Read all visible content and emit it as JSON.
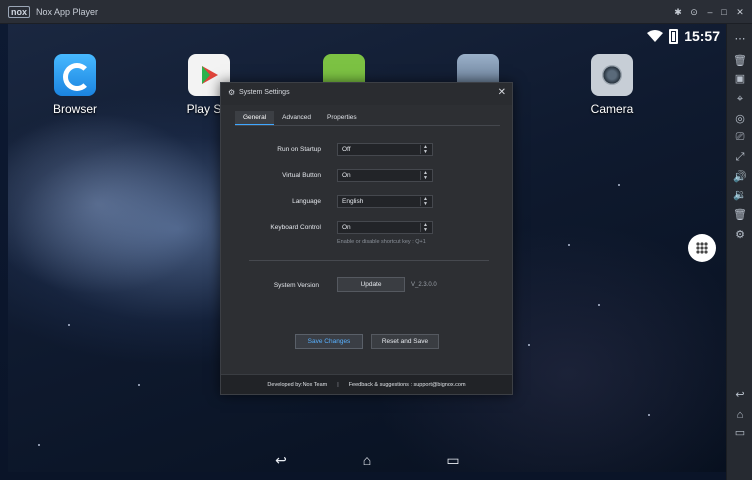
{
  "window": {
    "logo": "nox",
    "title": "Nox App Player"
  },
  "status": {
    "time": "15:57"
  },
  "apps": [
    {
      "label": "Browser",
      "icon": "browser-icon"
    },
    {
      "label": "Play Sto",
      "icon": "play-store-icon"
    },
    {
      "label": "",
      "icon": "games-icon"
    },
    {
      "label": "",
      "icon": "equalizer-icon"
    },
    {
      "label": "Camera",
      "icon": "camera-icon"
    }
  ],
  "dialog": {
    "title": "System Settings",
    "tabs": [
      "General",
      "Advanced",
      "Properties"
    ],
    "active_tab": "General",
    "rows": [
      {
        "label": "Run on Startup",
        "value": "Off"
      },
      {
        "label": "Virtual Button",
        "value": "On"
      },
      {
        "label": "Language",
        "value": "English"
      },
      {
        "label": "Keyboard Control",
        "value": "On"
      }
    ],
    "keyboard_hint": "Enable or disable shortcut key : Q+1",
    "system_version_label": "System Version",
    "update_label": "Update",
    "version": "V_2.3.0.0",
    "save_label": "Save Changes",
    "reset_label": "Reset and Save",
    "footer_dev": "Developed by:Nox Team",
    "footer_sep": "|",
    "footer_feedback": "Feedback & suggestions : support@bignox.com"
  },
  "colors": {
    "accent": "#3fa7ff",
    "dialog_bg": "#2d2f33",
    "sidebar_bg": "#262a31"
  }
}
